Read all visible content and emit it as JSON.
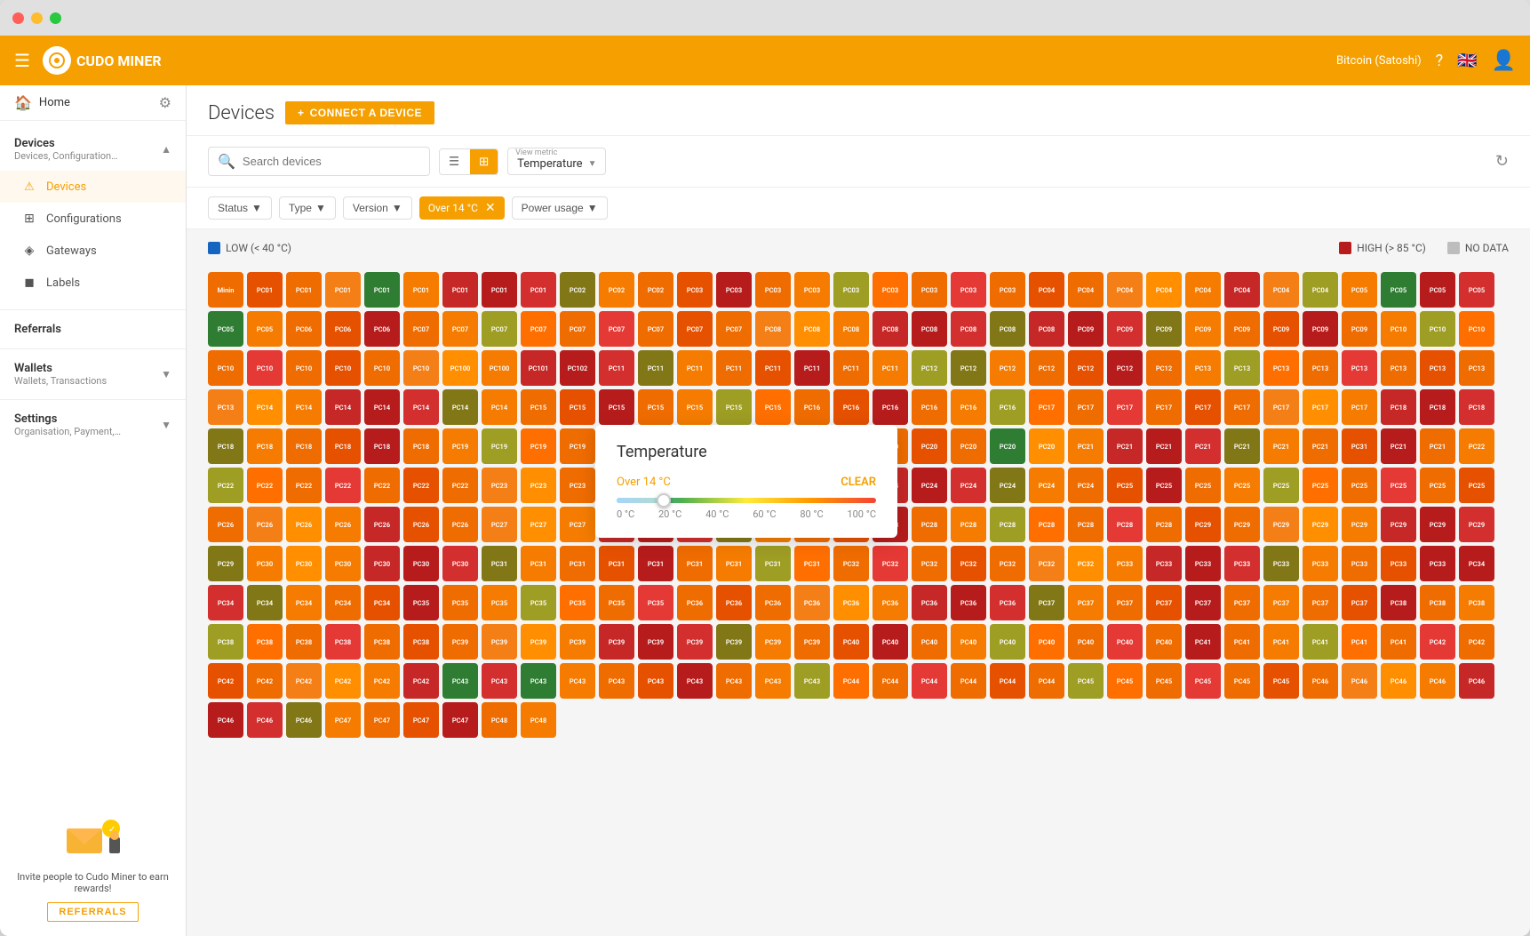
{
  "window": {
    "title": "Cudo Miner"
  },
  "topnav": {
    "currency": "Bitcoin (Satoshi)",
    "help_icon": "?",
    "logo_text": "CUDO MINER"
  },
  "sidebar": {
    "home_label": "Home",
    "settings_icon": "⚙",
    "devices_section": {
      "label": "Devices",
      "sublabel": "Devices, Configurations, Gat...",
      "items": [
        {
          "label": "Devices",
          "active": true
        },
        {
          "label": "Configurations",
          "active": false
        },
        {
          "label": "Gateways",
          "active": false
        },
        {
          "label": "Labels",
          "active": false
        }
      ]
    },
    "referrals": {
      "label": "Referrals"
    },
    "wallets": {
      "label": "Wallets",
      "sublabel": "Wallets, Transactions"
    },
    "settings": {
      "label": "Settings",
      "sublabel": "Organisation, Payment, Users"
    },
    "referral_cta": "Invite people to Cudo Miner to earn rewards!",
    "referral_btn": "REFERRALS"
  },
  "page": {
    "title": "Devices",
    "connect_btn": "CONNECT A DEVICE"
  },
  "toolbar": {
    "search_placeholder": "Search devices",
    "view_metric_label": "View metric",
    "view_metric_value": "Temperature"
  },
  "filters": {
    "status_label": "Status",
    "type_label": "Type",
    "version_label": "Version",
    "active_filter": "Over 14 °C",
    "power_usage_label": "Power usage"
  },
  "legend": {
    "low_label": "LOW (< 40 °C)",
    "high_label": "HIGH (> 85 °C)",
    "no_data_label": "NO DATA",
    "low_color": "#1565c0",
    "high_color": "#b71c1c",
    "no_data_color": "#bdbdbd"
  },
  "temperature_popup": {
    "title": "Temperature",
    "filter_label": "Over 14 °C",
    "clear_label": "CLEAR",
    "slider_min": "0 °C",
    "slider_20": "20 °C",
    "slider_40": "40 °C",
    "slider_60": "60 °C",
    "slider_80": "80 °C",
    "slider_100": "100 °C"
  },
  "devices": {
    "colors": {
      "red": "#d32f2f",
      "dark_red": "#b71c1c",
      "orange": "#e65100",
      "orange2": "#ef6c00",
      "amber": "#ff8f00",
      "yellow": "#f9a825",
      "lime": "#9e9d24",
      "green": "#2e7d32",
      "light_green": "#558b2f",
      "yellow2": "#f57f17",
      "gray": "#9e9e9e"
    }
  }
}
